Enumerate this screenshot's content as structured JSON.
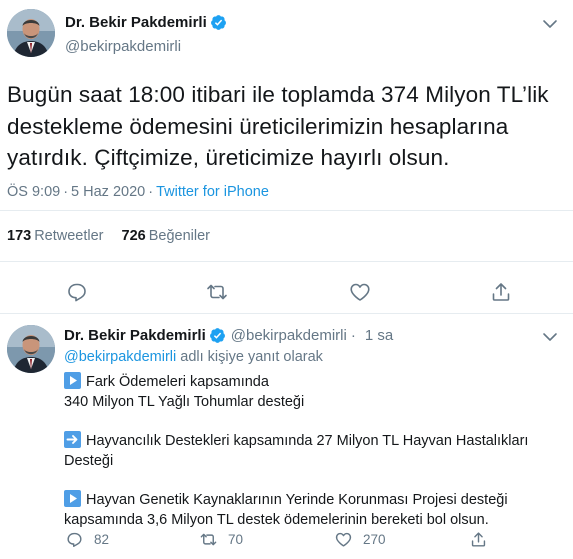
{
  "main_tweet": {
    "display_name": "Dr. Bekir Pakdemirli",
    "handle": "@bekirpakdemirli",
    "verified": true,
    "text": "Bugün saat 18:00 itibari ile toplamda 374 Milyon TL’lik\ndestekleme ödemesini üreticilerimizin hesaplarına\nyatırdık. Çiftçimize, üreticimize hayırlı olsun.",
    "time": "ÖS 9:09",
    "separator": "·",
    "date": "5 Haz 2020",
    "source": "Twitter for iPhone",
    "retweet_count": "173",
    "retweet_label": "Retweetler",
    "like_count": "726",
    "like_label": "Beğeniler"
  },
  "actions": {
    "icons": [
      "reply-icon",
      "retweet-icon",
      "like-icon",
      "share-icon"
    ]
  },
  "reply_tweet": {
    "display_name": "Dr. Bekir Pakdemirli",
    "handle": "@bekirpakdemirli",
    "dot": "·",
    "time_ago": "1 sa",
    "replying_mention": "@bekirpakdemirli",
    "replying_suffix": "adlı kişiye yanıt olarak",
    "para1_line1": "Fark Ödemeleri kapsamında",
    "para1_line2": "340 Milyon TL Yağlı Tohumlar desteği",
    "para2_line1": "Hayvancılık Destekleri kapsamında 27 Milyon TL Hayvan Hastalıkları",
    "para2_line2": "Desteği",
    "para3_line1": "Hayvan Genetik Kaynaklarının Yerinde Korunması Projesi desteği",
    "para3_line2": "kapsamında 3,6 Milyon TL destek ödemelerinin bereketi bol olsun.",
    "reply_count": "82",
    "retweet_count": "70",
    "like_count": "270"
  },
  "colors": {
    "accent": "#1b95e0",
    "muted": "#657786",
    "text": "#14171a",
    "border": "#e6ecf0",
    "emoji_blue": "#4f9ee6"
  }
}
